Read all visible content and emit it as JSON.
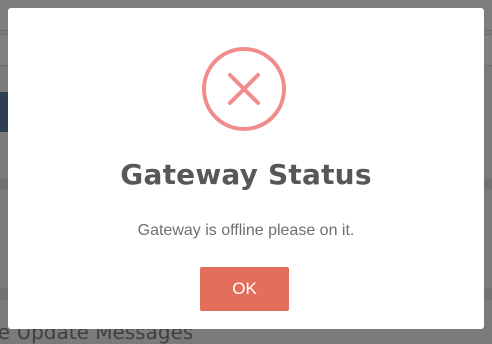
{
  "background": {
    "partial_heading": "re Update Messages"
  },
  "modal": {
    "title": "Gateway Status",
    "message": "Gateway is offline please on it.",
    "icon": "error-x-circle-icon",
    "ok_label": "OK"
  },
  "colors": {
    "accent_button": "#e36e5c",
    "icon_ring": "#f08c8c",
    "title_text": "#575757",
    "nav_block": "#2f3d57"
  }
}
